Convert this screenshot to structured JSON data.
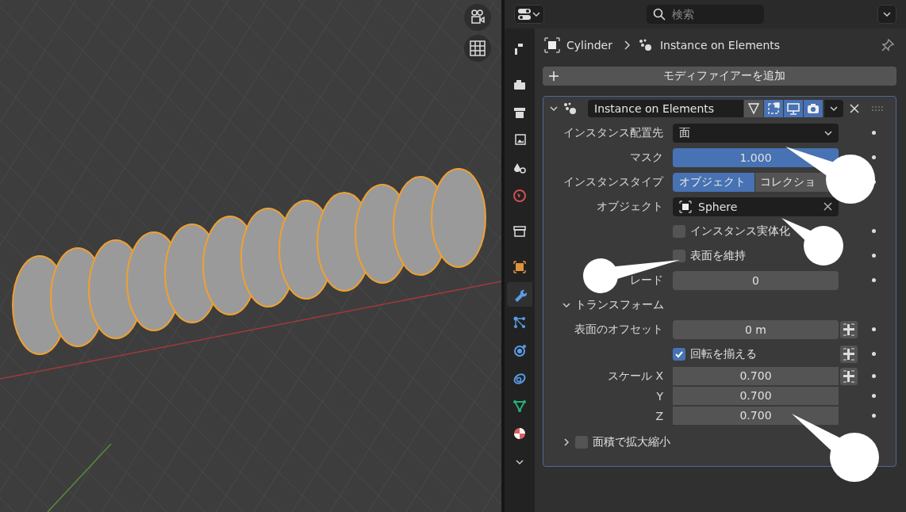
{
  "header": {
    "search_placeholder": "検索"
  },
  "tabs": [
    {
      "selected": false
    },
    {
      "selected": false
    },
    {
      "selected": false
    },
    {
      "selected": false
    },
    {
      "selected": false
    },
    {
      "selected": false
    },
    {
      "selected": false
    },
    {
      "selected": false
    },
    {
      "selected": true
    },
    {
      "selected": false
    },
    {
      "selected": false
    },
    {
      "selected": false
    },
    {
      "selected": false
    },
    {
      "selected": false
    }
  ],
  "breadcrumb": [
    "Cylinder",
    "Instance on Elements"
  ],
  "add_modifier": "モディファイアーを追加",
  "modifier": {
    "name": "Instance on Elements",
    "expanded": true,
    "toggles": [
      {
        "on": false
      },
      {
        "on": true
      },
      {
        "on": true
      },
      {
        "on": true
      }
    ],
    "rows": [
      {
        "kind": "dropdown",
        "label": "インスタンス配置先",
        "value": "面",
        "animatable": true
      },
      {
        "kind": "slider",
        "label": "マスク",
        "value": "1.000",
        "level": 1,
        "animatable": true
      },
      {
        "kind": "segmented",
        "label": "インスタンスタイプ",
        "options": [
          {
            "label": "オブジェクト",
            "selected": true
          },
          {
            "label": "コレクショ",
            "selected": false
          }
        ],
        "animatable": true
      },
      {
        "kind": "object",
        "label": "オブジェクト",
        "value": "Sphere",
        "animatable": false
      },
      {
        "kind": "checkbox",
        "label": "インスタンス実体化",
        "checked": false,
        "animatable": true
      },
      {
        "kind": "checkbox",
        "label": "表面を維持",
        "checked": false,
        "animatable": true
      },
      {
        "kind": "number",
        "label": "レード",
        "value": "0",
        "animatable": true
      },
      {
        "kind": "section",
        "label": "トランスフォーム",
        "expanded": true
      },
      {
        "kind": "number",
        "label": "表面のオフセット",
        "value": "0 m",
        "link": true,
        "animatable": true
      },
      {
        "kind": "checkbox",
        "label": "回転を揃える",
        "checked": true,
        "link": true,
        "animatable": true
      },
      {
        "kind": "number",
        "label": "スケール X",
        "value": "0.700",
        "link": true,
        "animatable": true,
        "joined": true
      },
      {
        "kind": "number",
        "label": "Y",
        "value": "0.700",
        "animatable": true,
        "joined": true
      },
      {
        "kind": "number",
        "label": "Z",
        "value": "0.700",
        "animatable": true,
        "joined": true
      },
      {
        "kind": "subpanel",
        "label": "面積で拡大縮小",
        "expanded": false,
        "checked": false
      }
    ]
  }
}
